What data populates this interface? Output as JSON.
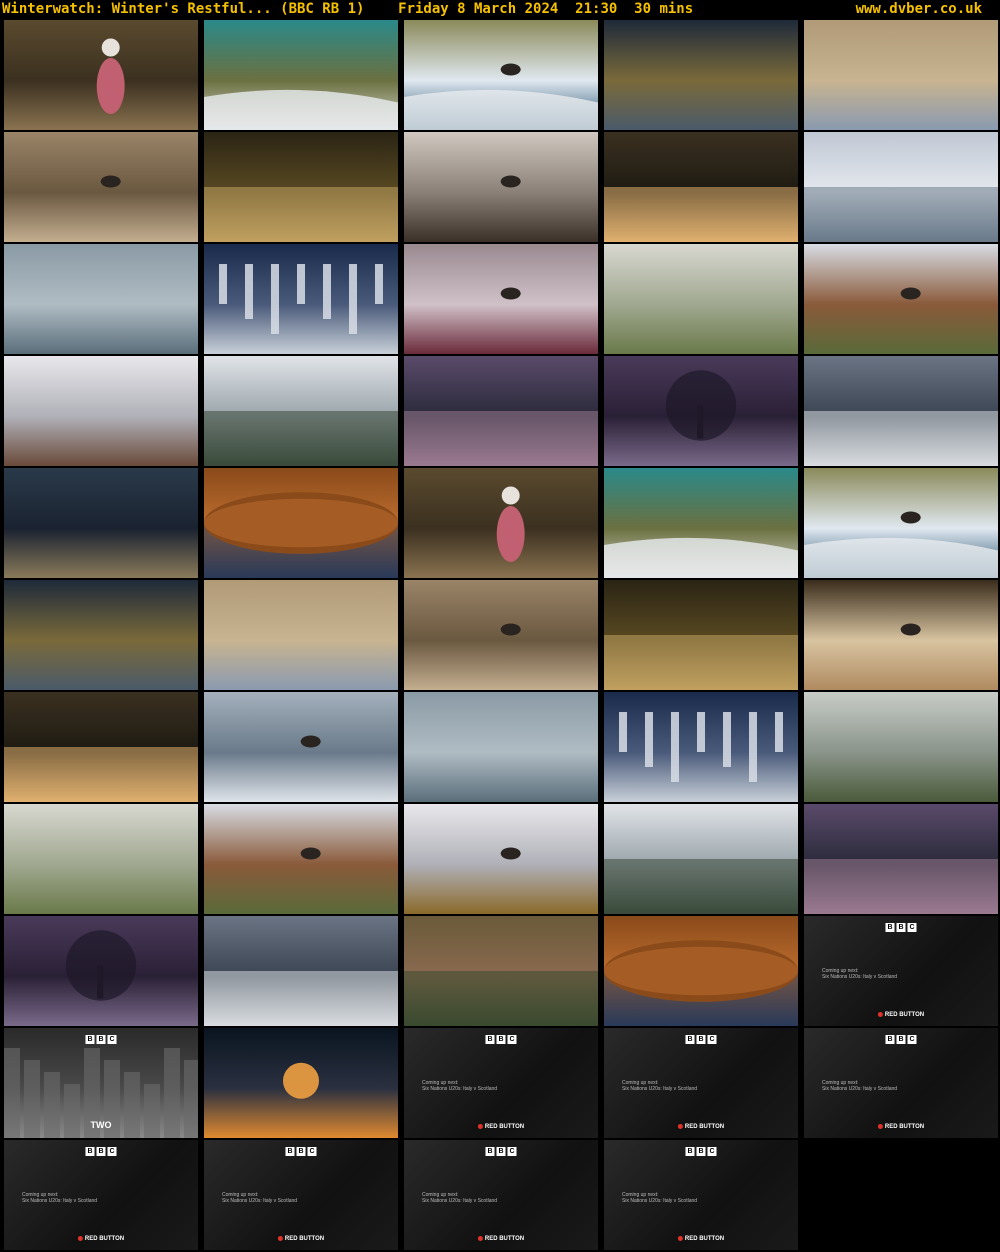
{
  "header": {
    "title": "Winterwatch: Winter's Restful... (BBC RB 1)    Friday 8 March 2024  21:30  30 mins",
    "site": "www.dvber.co.uk"
  },
  "colors": {
    "header_text": "#f5c000",
    "background": "#000000"
  },
  "bbc_card": {
    "logo": [
      "B",
      "B",
      "C"
    ],
    "coming_up": "Coming up next:",
    "programme": "Six Nations U20s: Italy v Scotland",
    "red_button": "RED BUTTON",
    "two_label": "TWO"
  },
  "thumbnails": [
    {
      "scene": "presenter-woods",
      "colors": [
        "#5a4a2e",
        "#8a7350",
        "#3b3020"
      ]
    },
    {
      "scene": "aerial-beach",
      "colors": [
        "#2a8a8a",
        "#d8d8d0",
        "#6b7040"
      ]
    },
    {
      "scene": "waves-birds",
      "colors": [
        "#8a8a5a",
        "#1d4a6a",
        "#e0e8f0"
      ]
    },
    {
      "scene": "dark-ripples",
      "colors": [
        "#1e2a3a",
        "#4a5a6a",
        "#7a6a3a"
      ]
    },
    {
      "scene": "reeds",
      "colors": [
        "#b09a78",
        "#8a9ab0",
        "#c8b490"
      ]
    },
    {
      "scene": "reed-birds",
      "colors": [
        "#9a8468",
        "#c4ae90",
        "#6a5840"
      ]
    },
    {
      "scene": "sunlit-pool",
      "colors": [
        "#2a2414",
        "#c0a060",
        "#5a4a22"
      ]
    },
    {
      "scene": "cormorant",
      "colors": [
        "#d0c8c0",
        "#3a3028",
        "#8a8078"
      ]
    },
    {
      "scene": "sunset-river",
      "colors": [
        "#3a3020",
        "#e0b070",
        "#1e1a12"
      ]
    },
    {
      "scene": "snowy-mountain-loch",
      "colors": [
        "#c0c8d4",
        "#6a7a8a",
        "#e4e8ee"
      ]
    },
    {
      "scene": "misty-slope",
      "colors": [
        "#8a9aa4",
        "#5a6e7a",
        "#b0bcc4"
      ]
    },
    {
      "scene": "icicles",
      "colors": [
        "#1a2a4a",
        "#c8d0d8",
        "#4a5a7a"
      ]
    },
    {
      "scene": "berries-blackbird",
      "colors": [
        "#9a8a90",
        "#6a2a3a",
        "#d0c0c8"
      ]
    },
    {
      "scene": "pine-frost",
      "colors": [
        "#d8d8d0",
        "#6a7a4a",
        "#a0a890"
      ]
    },
    {
      "scene": "snowy-branch-birds",
      "colors": [
        "#d8dce4",
        "#5a6a3a",
        "#8a5a3a"
      ]
    },
    {
      "scene": "snowy-twigs",
      "colors": [
        "#e8e8ec",
        "#6a4a3a",
        "#b0b0b8"
      ]
    },
    {
      "scene": "snowy-field-river",
      "colors": [
        "#e0e4e8",
        "#3a4a3a",
        "#9aa4aa"
      ]
    },
    {
      "scene": "purple-loch-house",
      "colors": [
        "#5a4a6a",
        "#9a7a90",
        "#2a2a3a"
      ]
    },
    {
      "scene": "purple-tree",
      "colors": [
        "#4a3a5a",
        "#7a6a8a",
        "#2a2036"
      ]
    },
    {
      "scene": "reflected-clouds",
      "colors": [
        "#6a7484",
        "#d8dce0",
        "#3a4452"
      ]
    },
    {
      "scene": "frosty-rocks",
      "colors": [
        "#2a3a4a",
        "#8a7a5a",
        "#1a2230"
      ]
    },
    {
      "scene": "autumn-hill-reflection",
      "colors": [
        "#8a4a1a",
        "#2a3a5a",
        "#c07030"
      ]
    },
    {
      "scene": "presenter-woods",
      "colors": [
        "#5a4a2e",
        "#8a7350",
        "#3b3020"
      ]
    },
    {
      "scene": "aerial-beach",
      "colors": [
        "#2a8a8a",
        "#d8d8d0",
        "#6b7040"
      ]
    },
    {
      "scene": "waves-birds",
      "colors": [
        "#8a8a5a",
        "#1d4a6a",
        "#e0e8f0"
      ]
    },
    {
      "scene": "dark-ripples",
      "colors": [
        "#1e2a3a",
        "#4a5a6a",
        "#7a6a3a"
      ]
    },
    {
      "scene": "reeds",
      "colors": [
        "#b09a78",
        "#8a9ab0",
        "#c8b490"
      ]
    },
    {
      "scene": "reed-birds",
      "colors": [
        "#9a8468",
        "#c4ae90",
        "#6a5840"
      ]
    },
    {
      "scene": "sunlit-pool",
      "colors": [
        "#2a2414",
        "#c0a060",
        "#5a4a22"
      ]
    },
    {
      "scene": "heron",
      "colors": [
        "#3a2c1c",
        "#b08a60",
        "#d8c4a0"
      ]
    },
    {
      "scene": "sunset-river",
      "colors": [
        "#3a3020",
        "#e0b070",
        "#1e1a12"
      ]
    },
    {
      "scene": "heron-flight-snow",
      "colors": [
        "#a4b0bc",
        "#dfe4ea",
        "#6a7a8a"
      ]
    },
    {
      "scene": "misty-slope",
      "colors": [
        "#8a9aa4",
        "#5a6e7a",
        "#b0bcc4"
      ]
    },
    {
      "scene": "icicles",
      "colors": [
        "#1a2a4a",
        "#c8d0d8",
        "#4a5a7a"
      ]
    },
    {
      "scene": "frosty-pine",
      "colors": [
        "#c8ccc8",
        "#4a5a3a",
        "#8a948a"
      ]
    },
    {
      "scene": "pine-frost",
      "colors": [
        "#d8d8d0",
        "#6a7a4a",
        "#a0a890"
      ]
    },
    {
      "scene": "snowy-branch-birds",
      "colors": [
        "#d8dce4",
        "#5a6a3a",
        "#8a5a3a"
      ]
    },
    {
      "scene": "snowy-twigs-bird",
      "colors": [
        "#e8e8ec",
        "#8a6a2a",
        "#b0b0b8"
      ]
    },
    {
      "scene": "snowy-field-river",
      "colors": [
        "#e0e4e8",
        "#3a4a3a",
        "#9aa4aa"
      ]
    },
    {
      "scene": "purple-loch-house",
      "colors": [
        "#5a4a6a",
        "#9a7a90",
        "#2a2a3a"
      ]
    },
    {
      "scene": "purple-tree",
      "colors": [
        "#4a3a5a",
        "#7a6a8a",
        "#2a2036"
      ]
    },
    {
      "scene": "reflected-clouds",
      "colors": [
        "#6a7484",
        "#d8dce0",
        "#3a4452"
      ]
    },
    {
      "scene": "reed-shore-reflection",
      "colors": [
        "#6a5a3a",
        "#3a4a30",
        "#8a6a50"
      ]
    },
    {
      "scene": "autumn-hill-reflection",
      "colors": [
        "#8a4a1a",
        "#2a3a5a",
        "#c07030"
      ]
    },
    {
      "scene": "bbc-card",
      "colors": []
    },
    {
      "scene": "bbc-two-city",
      "colors": [
        "#2a2a2a",
        "#8a8a8a",
        "#4a4a4a"
      ]
    },
    {
      "scene": "fire-dark",
      "colors": [
        "#0a1420",
        "#e08a30",
        "#2a3040"
      ]
    },
    {
      "scene": "bbc-card",
      "colors": []
    },
    {
      "scene": "bbc-card",
      "colors": []
    },
    {
      "scene": "bbc-card",
      "colors": []
    },
    {
      "scene": "bbc-card",
      "colors": []
    },
    {
      "scene": "bbc-card",
      "colors": []
    },
    {
      "scene": "bbc-card",
      "colors": []
    },
    {
      "scene": "bbc-card",
      "colors": []
    }
  ]
}
